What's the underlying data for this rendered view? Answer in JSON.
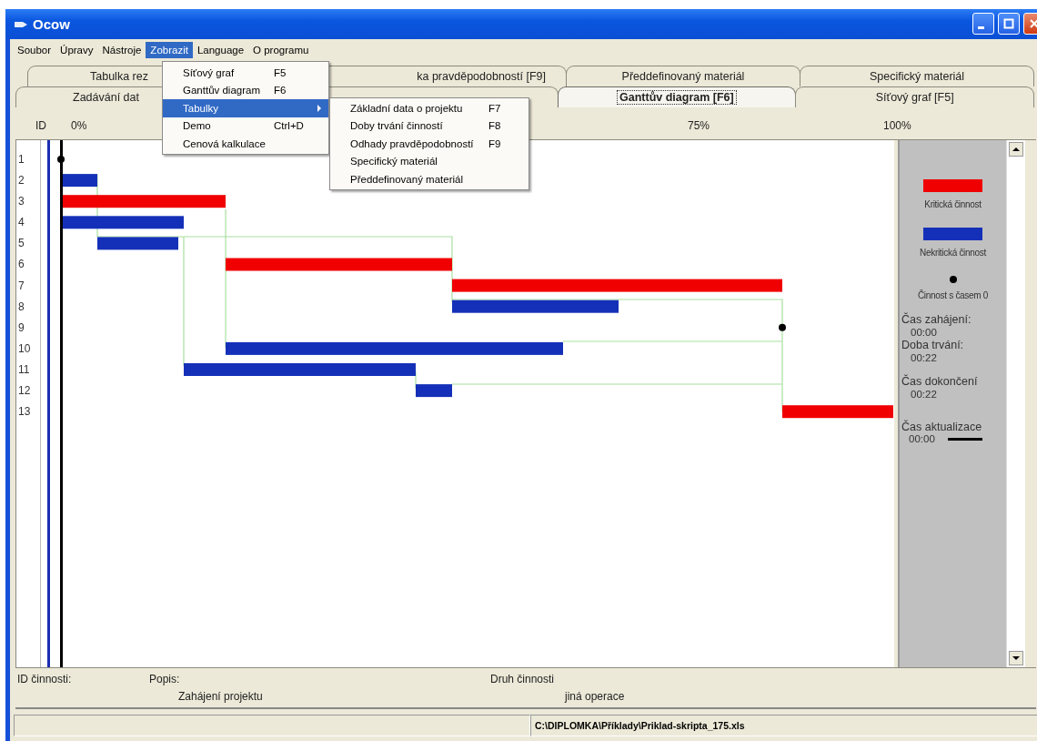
{
  "window": {
    "title": "Ocow"
  },
  "menu_bar": [
    {
      "label": "Soubor",
      "selected": false
    },
    {
      "label": "Úpravy",
      "selected": false
    },
    {
      "label": "Nástroje",
      "selected": false
    },
    {
      "label": "Zobrazit",
      "selected": true
    },
    {
      "label": "Language",
      "selected": false
    },
    {
      "label": "O programu",
      "selected": false
    }
  ],
  "dropdown": {
    "items": [
      {
        "label": "Síťový graf",
        "shortcut": "F5",
        "selected": false,
        "submenu": false
      },
      {
        "label": "Ganttův diagram",
        "shortcut": "F6",
        "selected": false,
        "submenu": false
      },
      {
        "label": "Tabulky",
        "selected": true,
        "submenu": true
      },
      {
        "label": "Demo",
        "shortcut": "Ctrl+D",
        "selected": false,
        "submenu": false
      },
      {
        "label": "Cenová kalkulace",
        "selected": false,
        "submenu": false
      }
    ]
  },
  "submenu": {
    "items": [
      {
        "label": "Základní data o projektu",
        "shortcut": "F7"
      },
      {
        "label": "Doby trvání činností",
        "shortcut": "F8"
      },
      {
        "label": "Odhady pravděpodobností",
        "shortcut": "F9"
      },
      {
        "label": "Specifický materiál"
      },
      {
        "label": "Předdefinovaný materiál"
      }
    ]
  },
  "tabs": {
    "back_row": [
      {
        "label": "Tabulka rez",
        "selected": false
      },
      {
        "label": "ka pravděpodobností  [F9]",
        "selected": false
      },
      {
        "label": "Předdefinovaný materiál",
        "selected": false
      },
      {
        "label": "Specifický materiál",
        "selected": false
      }
    ],
    "front_row": [
      {
        "label": "Zadávání dat",
        "selected": false
      },
      {
        "selected": false
      },
      {
        "label": "Ganttův diagram   [F6]",
        "selected": true
      },
      {
        "label": "Síťový graf   [F5]",
        "selected": false
      }
    ]
  },
  "scale": {
    "id_label": "ID",
    "ticks": [
      "0%",
      "75%",
      "100%"
    ]
  },
  "activities": [
    {
      "number": "1",
      "kind": "milestone"
    },
    {
      "number": "2",
      "kind": "noncritical"
    },
    {
      "number": "3",
      "kind": "critical"
    },
    {
      "number": "4",
      "kind": "noncritical"
    },
    {
      "number": "5",
      "kind": "noncritical"
    },
    {
      "number": "6",
      "kind": "critical"
    },
    {
      "number": "7",
      "kind": "critical"
    },
    {
      "number": "8",
      "kind": "noncritical"
    },
    {
      "number": "9",
      "kind": "milestone"
    },
    {
      "number": "10",
      "kind": "noncritical"
    },
    {
      "number": "11",
      "kind": "noncritical"
    },
    {
      "number": "12",
      "kind": "noncritical"
    },
    {
      "number": "13",
      "kind": "critical"
    }
  ],
  "legend": {
    "items": [
      {
        "kind": "critical",
        "label": "Kritická činnost"
      },
      {
        "kind": "noncritical",
        "label": "Nekritická činnost"
      },
      {
        "kind": "milestone",
        "label": "Činnost s časem 0"
      }
    ],
    "times": [
      {
        "label": "Čas zahájení:",
        "value": "00:00",
        "kind": "plain"
      },
      {
        "label": "Doba trvání:",
        "value": "00:22",
        "kind": "plain"
      },
      {
        "label": "Čas dokončení",
        "value": "00:22",
        "kind": "plain"
      },
      {
        "label": "Čas aktualizace",
        "value": "00:00",
        "kind": "line"
      }
    ]
  },
  "details": {
    "id_label": "ID činnosti:",
    "description_label": "Popis:",
    "description": "Zahájení projektu",
    "type_label": "Druh činnosti",
    "type": "jiná operace"
  },
  "status_bar": {
    "path": "C:\\DIPLOMKA\\Příklady\\Priklad-skripta_175.xls"
  }
}
